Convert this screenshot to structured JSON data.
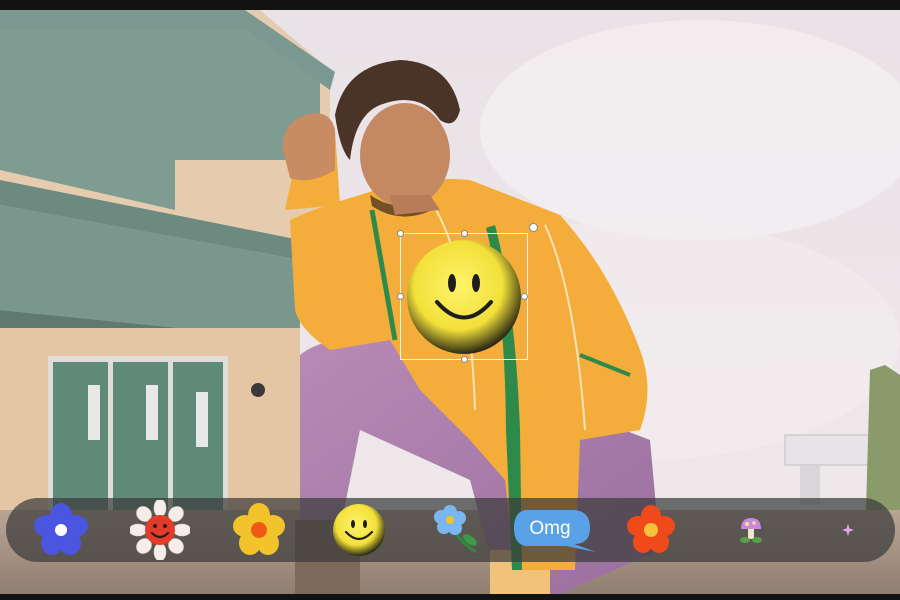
{
  "canvas": {
    "selected_sticker": "smiley-face-sticker"
  },
  "sticker_tray": {
    "items": [
      {
        "icon": "blue-flower-icon"
      },
      {
        "icon": "smiling-daisy-icon"
      },
      {
        "icon": "yellow-flower-icon"
      },
      {
        "icon": "smiley-face-icon"
      },
      {
        "icon": "blue-flower-stem-icon"
      },
      {
        "icon": "omg-speech-bubble-icon",
        "label": "Omg"
      },
      {
        "icon": "orange-flower-icon"
      },
      {
        "icon": "mushroom-icon"
      },
      {
        "icon": "small-sparkle-icon"
      }
    ]
  },
  "colors": {
    "smiley": "#f2e03a",
    "omg_bubble": "#5aa2e8",
    "blue_flower": "#4a55e0",
    "orange_flower": "#f04a1a"
  }
}
